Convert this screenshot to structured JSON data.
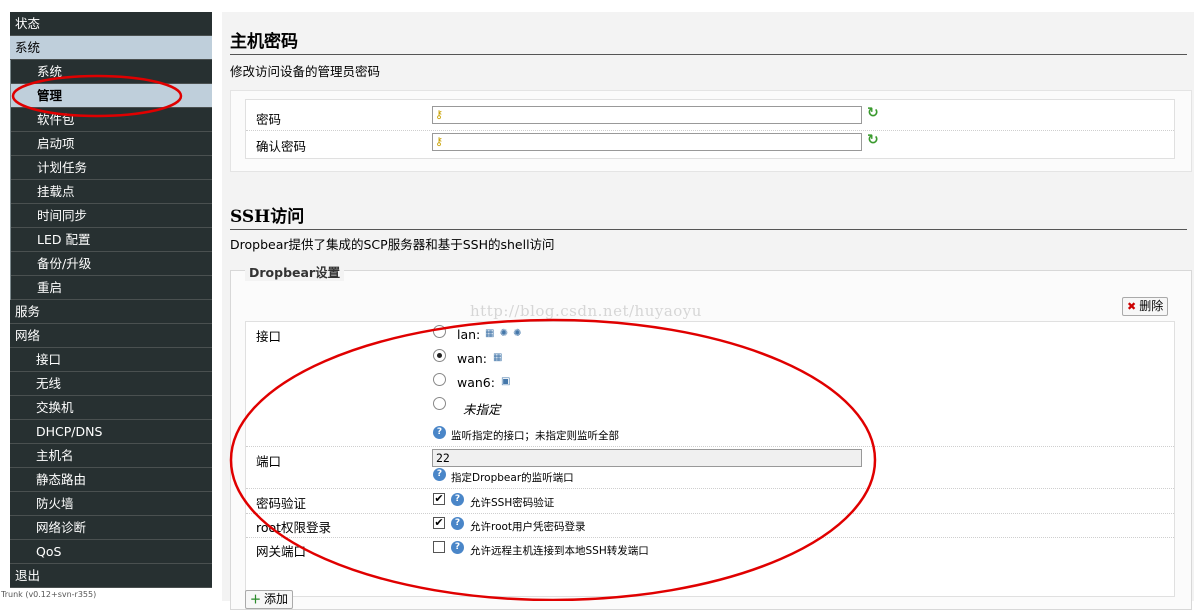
{
  "sidebar": {
    "status": "状态",
    "system": "系统",
    "system_items": [
      "系统",
      "管理",
      "软件包",
      "启动项",
      "计划任务",
      "挂载点",
      "时间同步",
      "LED 配置",
      "备份/升级",
      "重启"
    ],
    "services": "服务",
    "network": "网络",
    "network_items": [
      "接口",
      "无线",
      "交换机",
      "DHCP/DNS",
      "主机名",
      "静态路由",
      "防火墙",
      "网络诊断",
      "QoS"
    ],
    "logout": "退出",
    "version": "Trunk (v0.12+svn-r355)"
  },
  "host_password": {
    "title": "主机密码",
    "desc": "修改访问设备的管理员密码",
    "password_label": "密码",
    "confirm_label": "确认密码",
    "password_value": "",
    "confirm_value": ""
  },
  "ssh": {
    "title": "SSH访问",
    "desc": "Dropbear提供了集成的SCP服务器和基于SSH的shell访问",
    "legend": "Dropbear设置",
    "delete_label": "删除",
    "interface_label": "接口",
    "interfaces": [
      {
        "name": "lan:",
        "selected": false
      },
      {
        "name": "wan:",
        "selected": true
      },
      {
        "name": "wan6:",
        "selected": false
      },
      {
        "name": "未指定",
        "selected": false
      }
    ],
    "interface_help": "监听指定的接口；未指定则监听全部",
    "port_label": "端口",
    "port_value": "22",
    "port_help": "指定Dropbear的监听端口",
    "password_auth_label": "密码验证",
    "password_auth_checked": true,
    "password_auth_help": "允许SSH密码验证",
    "root_login_label": "root权限登录",
    "root_login_checked": true,
    "root_login_help": "允许root用户凭密码登录",
    "gateway_ports_label": "网关端口",
    "gateway_ports_checked": false,
    "gateway_ports_help": "允许远程主机连接到本地SSH转发端口",
    "add_label": "添加"
  },
  "watermark": "http://blog.csdn.net/huyaoyu",
  "colors": {
    "sidebar_bg": "#273031",
    "sidebar_active": "#bfcfdb",
    "annotation": "#e00000"
  }
}
